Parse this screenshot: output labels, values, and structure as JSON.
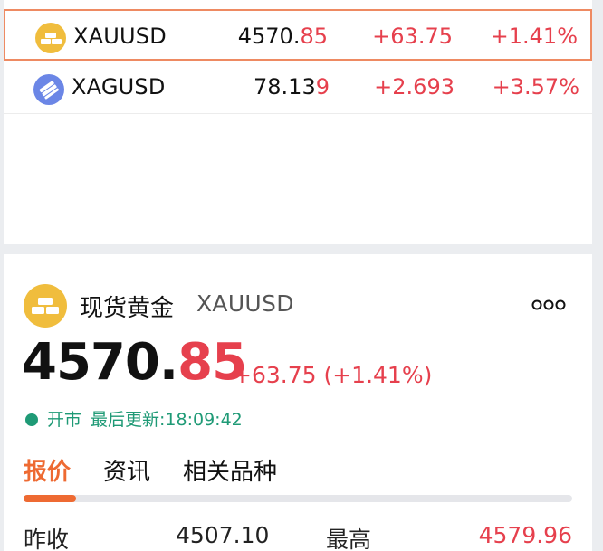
{
  "watchlist": [
    {
      "symbol": "XAUUSD",
      "price_main": "4570.",
      "price_tail": "85",
      "change": "+63.75",
      "change_pct": "+1.41%",
      "icon": "gold-bars-icon",
      "selected": true
    },
    {
      "symbol": "XAGUSD",
      "price_main": "78.13",
      "price_tail": "9",
      "change": "+2.693",
      "change_pct": "+3.57%",
      "icon": "silver-bars-icon",
      "selected": false
    }
  ],
  "detail": {
    "name": "现货黄金",
    "symbol": "XAUUSD",
    "price_main": "4570.",
    "price_tail": "85",
    "change_text": "+63.75 (+1.41%)",
    "status": "开市",
    "updated_label": "最后更新:",
    "updated_time": "18:09:42",
    "more_icon": "more-dots-icon"
  },
  "tabs": [
    {
      "label": "报价",
      "active": true
    },
    {
      "label": "资讯",
      "active": false
    },
    {
      "label": "相关品种",
      "active": false
    }
  ],
  "quote": {
    "prev_close_label": "昨收",
    "prev_close_value": "4507.10",
    "high_label": "最高",
    "high_value": "4579.96"
  },
  "colors": {
    "up_red": "#e6404d",
    "accent_orange": "#ee6a32",
    "highlight_border": "#ee8a62",
    "gold": "#f0bd3d",
    "silver_blue": "#6b86e6",
    "status_green": "#1f9a76"
  }
}
